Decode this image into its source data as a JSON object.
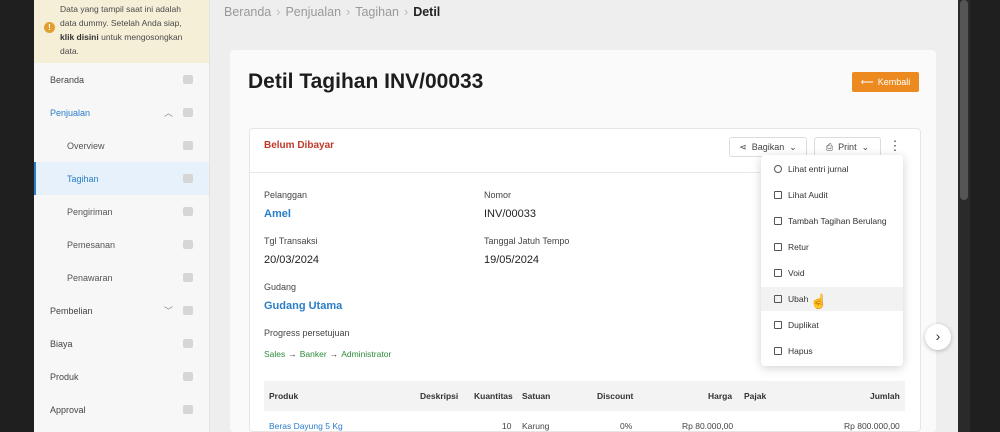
{
  "notice": {
    "line1": "Data yang tampil saat ini adalah",
    "line2_pre": "data dummy. Setelah Anda siap,",
    "link": "klik disini",
    "line3_post": "untuk mengosongkan",
    "line4": "data."
  },
  "sidebar": {
    "items": [
      {
        "label": "Beranda"
      },
      {
        "label": "Penjualan"
      },
      {
        "label": "Overview"
      },
      {
        "label": "Tagihan"
      },
      {
        "label": "Pengiriman"
      },
      {
        "label": "Pemesanan"
      },
      {
        "label": "Penawaran"
      },
      {
        "label": "Pembelian"
      },
      {
        "label": "Biaya"
      },
      {
        "label": "Produk"
      },
      {
        "label": "Approval"
      }
    ]
  },
  "breadcrumb": {
    "b1": "Beranda",
    "b2": "Penjualan",
    "b3": "Tagihan",
    "current": "Detil",
    "sep": "›"
  },
  "page": {
    "title": "Detil Tagihan INV/00033",
    "back_label": "Kembali"
  },
  "invoice": {
    "status": "Belum Dibayar",
    "share_label": "Bagikan",
    "print_label": "Print",
    "customer_label": "Pelanggan",
    "customer": "Amel",
    "number_label": "Nomor",
    "number": "INV/00033",
    "date_label": "Tgl Transaksi",
    "date": "20/03/2024",
    "due_label": "Tanggal Jatuh Tempo",
    "due": "19/05/2024",
    "warehouse_label": "Gudang",
    "warehouse": "Gudang Utama",
    "approval_label": "Progress persetujuan",
    "approval_steps": [
      "Sales",
      "Banker",
      "Administrator"
    ]
  },
  "table": {
    "headers": [
      "Produk",
      "Deskripsi",
      "Kuantitas",
      "Satuan",
      "Discount",
      "Harga",
      "Pajak",
      "Jumlah"
    ],
    "rows": [
      {
        "produk": "Beras Dayung 5 Kg",
        "kuantitas": "10",
        "satuan": "Karung",
        "discount": "0%",
        "harga": "Rp 80.000,00",
        "jumlah": "Rp 800.000,00"
      }
    ]
  },
  "menu": {
    "items": [
      {
        "label": "Lihat entri jurnal"
      },
      {
        "label": "Lihat Audit"
      },
      {
        "label": "Tambah Tagihan Berulang"
      },
      {
        "label": "Retur"
      },
      {
        "label": "Void"
      },
      {
        "label": "Ubah"
      },
      {
        "label": "Duplikat"
      },
      {
        "label": "Hapus"
      }
    ]
  }
}
